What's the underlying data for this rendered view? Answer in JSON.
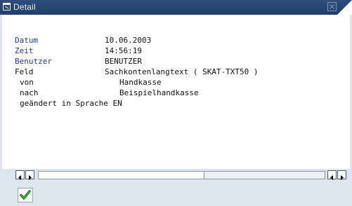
{
  "window": {
    "title": "Detail",
    "icons": {
      "window": "window-icon",
      "close": "close-icon",
      "ok": "checkmark-icon",
      "scroll_left": "arrow-left-icon",
      "scroll_right": "arrow-right-icon"
    }
  },
  "fields": {
    "datum": {
      "label": "Datum",
      "value": "10.06.2003"
    },
    "zeit": {
      "label": "Zeit",
      "value": "14:56:19"
    },
    "benutzer": {
      "label": "Benutzer",
      "value": "BENUTZER"
    },
    "feld": {
      "label": "Feld",
      "value": "Sachkontenlangtext ( SKAT-TXT50 )"
    },
    "von": {
      "label": "von",
      "value": "Handkasse"
    },
    "nach": {
      "label": "nach",
      "value": "Beispielhandkasse"
    },
    "sprache": {
      "label": "geändert in Sprache EN"
    }
  },
  "colors": {
    "titlebar": "#213e6a",
    "label_blue": "#1e3a8a",
    "ok_green": "#1f8f1f"
  }
}
